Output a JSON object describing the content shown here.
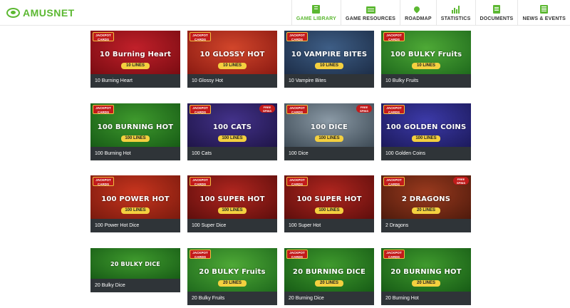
{
  "brand": {
    "name": "AMUSNET"
  },
  "nav": [
    {
      "label": "GAME LIBRARY",
      "icon": "book-icon",
      "active": true
    },
    {
      "label": "GAME RESOURCES",
      "icon": "resources-icon",
      "active": false
    },
    {
      "label": "ROADMAP",
      "icon": "map-pin-icon",
      "active": false
    },
    {
      "label": "STATISTICS",
      "icon": "statistics-icon",
      "active": false
    },
    {
      "label": "DOCUMENTS",
      "icon": "document-icon",
      "active": false
    },
    {
      "label": "NEWS & EVENTS",
      "icon": "news-icon",
      "active": false
    }
  ],
  "colors": {
    "accent": "#5cb832",
    "caption_bg": "#2f3438"
  },
  "badges": {
    "jackpot": "JACKPOT CARDS",
    "free_spins": "FREE SPINS"
  },
  "games": [
    {
      "name": "10 Burning Heart",
      "art_title": "10 Burning Heart",
      "lines": "10 LINES",
      "bg": "#c1202a",
      "bg2": "#7a0c12"
    },
    {
      "name": "10 Glossy Hot",
      "art_title": "10 GLOSSY HOT",
      "lines": "10 LINES",
      "bg": "#d2462b",
      "bg2": "#8b1a12"
    },
    {
      "name": "10 Vampire Bites",
      "art_title": "10 VAMPIRE BITES",
      "lines": "10 LINES",
      "bg": "#3e5e86",
      "bg2": "#1d2e48"
    },
    {
      "name": "10 Bulky Fruits",
      "art_title": "100 BULKY Fruits",
      "lines": "10 LINES",
      "bg": "#4ea936",
      "bg2": "#1f6a1d"
    },
    {
      "name": "100 Burning Hot",
      "art_title": "100 BURNING HOT",
      "lines": "100 LINES",
      "bg": "#3f9a2d",
      "bg2": "#175c16"
    },
    {
      "name": "100 Cats",
      "art_title": "100 CATS",
      "lines": "100 LINES",
      "bg": "#43328a",
      "bg2": "#1f1548"
    },
    {
      "name": "100 Dice",
      "art_title": "100 DICE",
      "lines": "100 LINES",
      "bg": "#8b9aa6",
      "bg2": "#3d4a55"
    },
    {
      "name": "100 Golden Coins",
      "art_title": "100 GOLDEN COINS",
      "lines": "100 LINES",
      "bg": "#3c3aa8",
      "bg2": "#1c1a5c"
    },
    {
      "name": "100 Power Hot Dice",
      "art_title": "100 POWER HOT",
      "lines": "100 LINES",
      "bg": "#c8351e",
      "bg2": "#7a1a0e"
    },
    {
      "name": "100 Super Dice",
      "art_title": "100 SUPER HOT",
      "lines": "100 LINES",
      "bg": "#b1261f",
      "bg2": "#5e0e0c"
    },
    {
      "name": "100 Super Hot",
      "art_title": "100 SUPER HOT",
      "lines": "100 LINES",
      "bg": "#b1261f",
      "bg2": "#5e0e0c"
    },
    {
      "name": "2 Dragons",
      "art_title": "2 DRAGONS",
      "lines": "20 LINES",
      "bg": "#9a3a1e",
      "bg2": "#4e1a0c"
    },
    {
      "name": "20 Bulky Dice",
      "art_title": "20 BULKY DICE",
      "lines": "",
      "bg": "#3f9a2d",
      "bg2": "#175c16"
    },
    {
      "name": "20 Bulky Fruits",
      "art_title": "20 BULKY Fruits",
      "lines": "20 LINES",
      "bg": "#4ea936",
      "bg2": "#1f6a1d"
    },
    {
      "name": "20 Burning Dice",
      "art_title": "20 BURNING DICE",
      "lines": "20 LINES",
      "bg": "#3f9a2d",
      "bg2": "#175c16"
    },
    {
      "name": "20 Burning Hot",
      "art_title": "20 BURNING HOT",
      "lines": "20 LINES",
      "bg": "#3f9a2d",
      "bg2": "#175c16"
    }
  ]
}
